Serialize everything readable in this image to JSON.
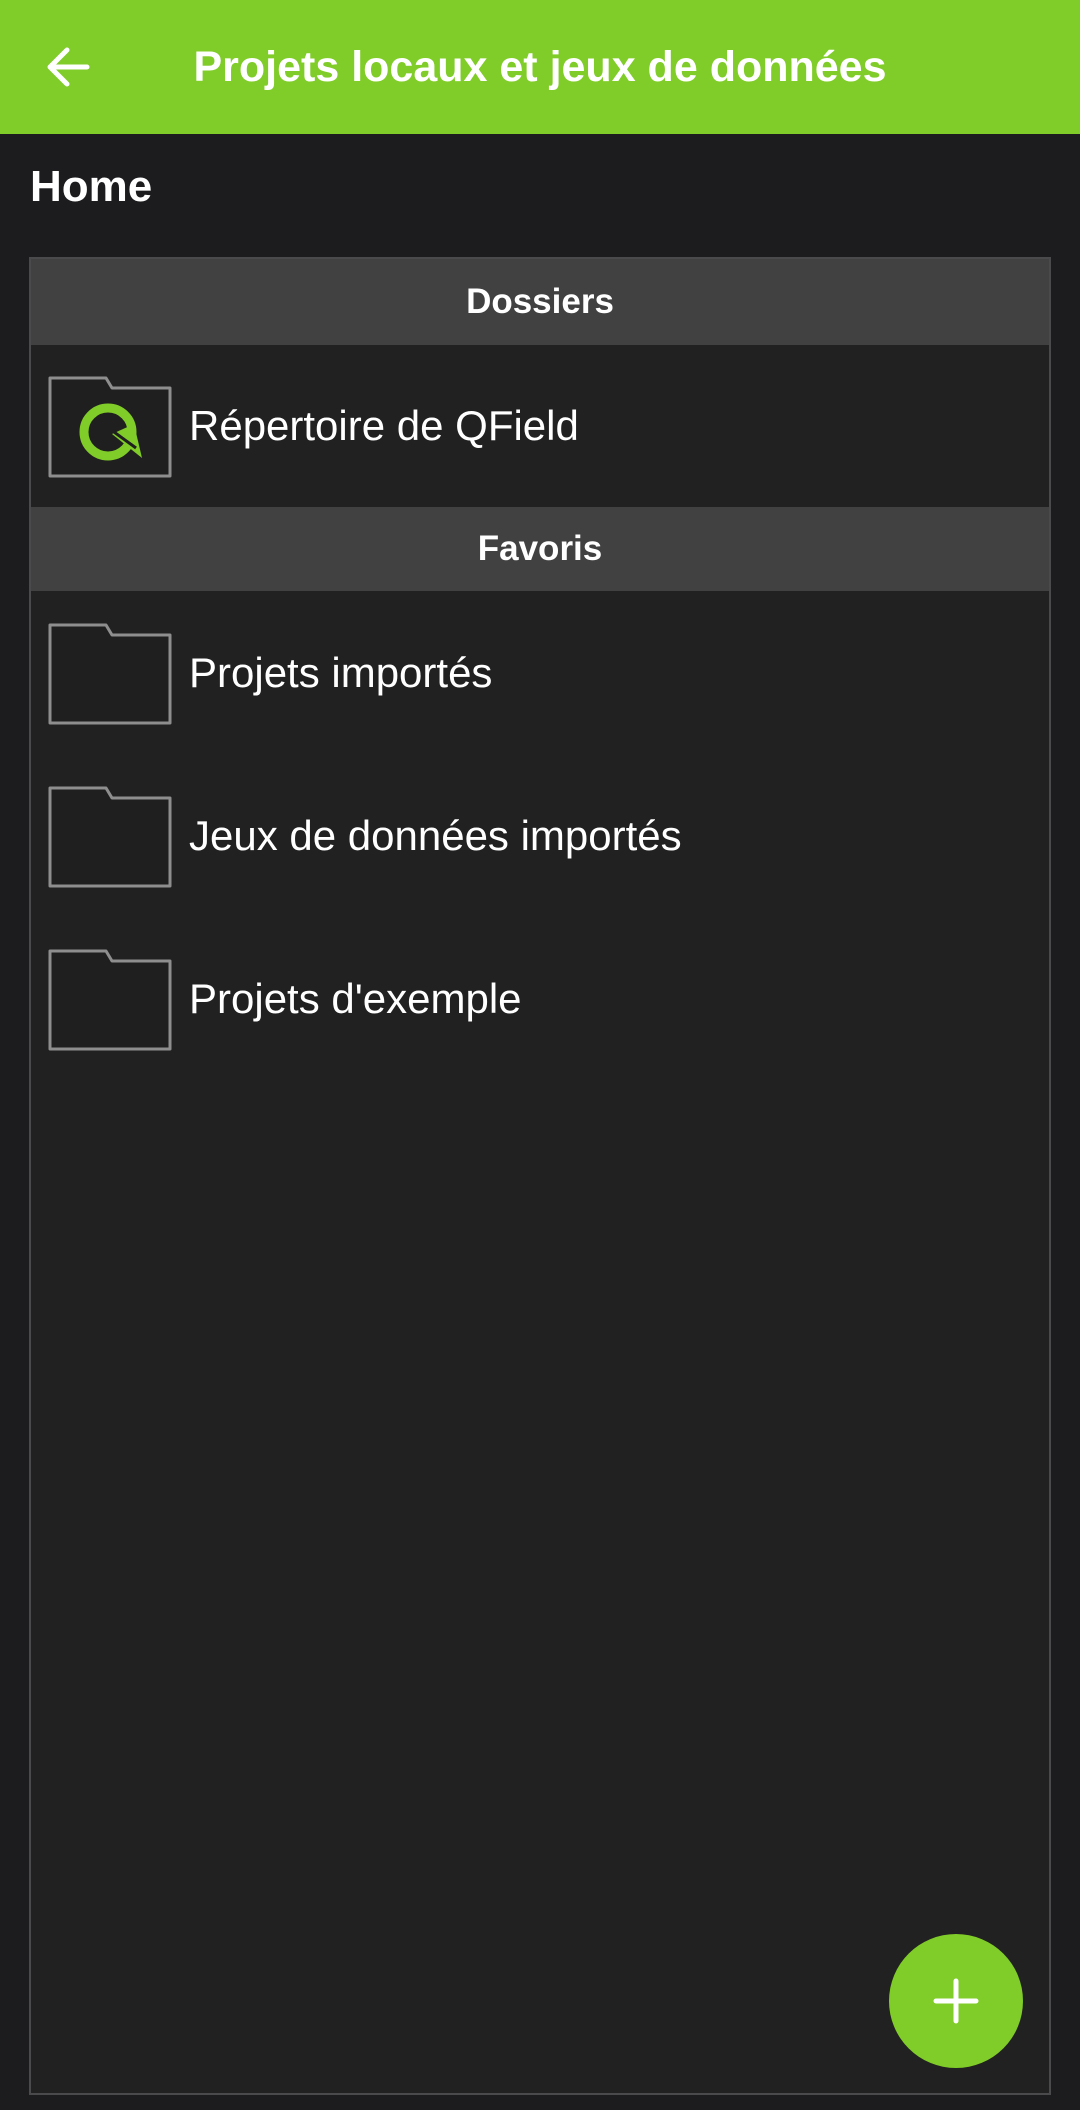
{
  "header": {
    "title": "Projets locaux et jeux de données",
    "back_icon": "arrow-left-icon",
    "background_color": "#80cc28"
  },
  "breadcrumb": {
    "label": "Home"
  },
  "sections": {
    "dossiers": {
      "title": "Dossiers",
      "items": [
        {
          "label": "Répertoire de QField",
          "icon": "qfield-folder-icon"
        }
      ]
    },
    "favoris": {
      "title": "Favoris",
      "items": [
        {
          "label": "Projets importés",
          "icon": "folder-icon"
        },
        {
          "label": "Jeux de données importés",
          "icon": "folder-icon"
        },
        {
          "label": "Projets d'exemple",
          "icon": "folder-icon"
        }
      ]
    }
  },
  "fab": {
    "icon": "plus-icon",
    "color": "#80cc28"
  }
}
